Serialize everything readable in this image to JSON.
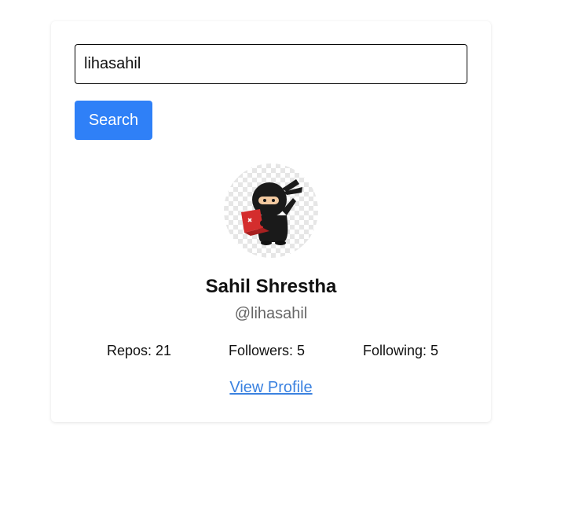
{
  "search": {
    "value": "lihasahil",
    "button_label": "Search"
  },
  "profile": {
    "avatar_icon": "ninja-avatar-icon",
    "name": "Sahil Shrestha",
    "username": "@lihasahil",
    "stats": {
      "repos": "Repos: 21",
      "followers": "Followers: 5",
      "following": "Following: 5"
    },
    "view_profile_label": "View Profile"
  },
  "colors": {
    "accent": "#2f80f7",
    "link": "#3b82e0",
    "muted_text": "#666666"
  }
}
